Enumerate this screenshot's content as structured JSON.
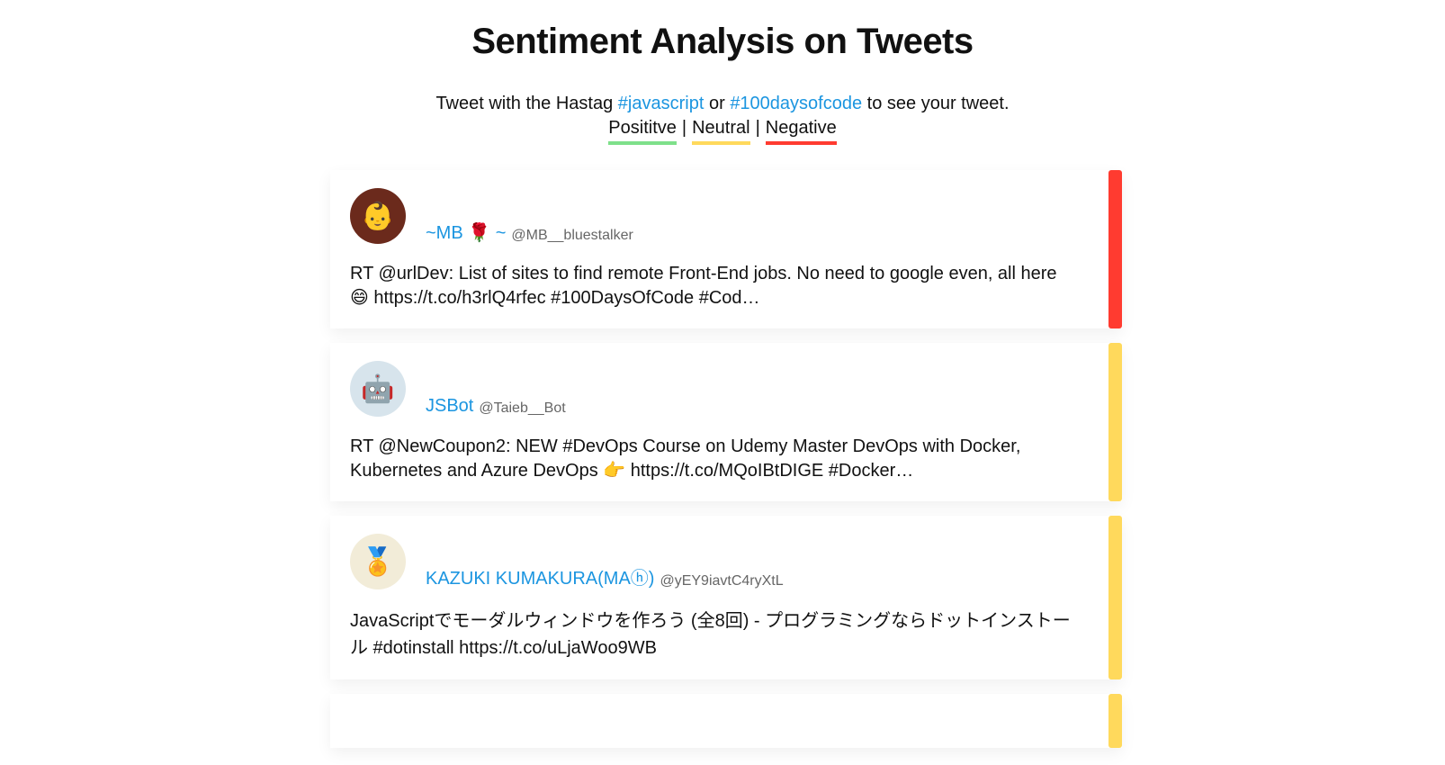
{
  "title": "Sentiment Analysis on Tweets",
  "subtitle": {
    "prefix": "Tweet with the Hastag",
    "tag1": "#javascript",
    "middle": "or",
    "tag2": "#100daysofcode",
    "suffix": "to see your tweet."
  },
  "legend": {
    "positive": "Posititve",
    "neutral": "Neutral",
    "negative": "Negative",
    "separator": "|"
  },
  "colors": {
    "positive": "#7ee08a",
    "neutral": "#ffd95c",
    "negative": "#ff3b30",
    "link": "#1b95e0"
  },
  "tweets": [
    {
      "name": "~MB 🌹 ~",
      "handle": "@MB__bluestalker",
      "text": "RT @urlDev: List of sites to find remote Front-End jobs. No need to google even, all here 😄 https://t.co/h3rlQ4rfec #100DaysOfCode #Cod…",
      "sentiment": "negative",
      "avatar_icon": "👶"
    },
    {
      "name": "JSBot",
      "handle": "@Taieb__Bot",
      "text": "RT @NewCoupon2: NEW #DevOps Course on Udemy Master DevOps with Docker, Kubernetes and Azure DevOps 👉 https://t.co/MQoIBtDIGE #Docker…",
      "sentiment": "neutral",
      "avatar_icon": "🤖"
    },
    {
      "name": "KAZUKI KUMAKURA(MAⓗ)",
      "handle": "@yEY9iavtC4ryXtL",
      "text": "JavaScriptでモーダルウィンドウを作ろう (全8回) - プログラミングならドットインストール #dotinstall https://t.co/uLjaWoo9WB",
      "sentiment": "neutral",
      "avatar_icon": "🏅"
    }
  ]
}
